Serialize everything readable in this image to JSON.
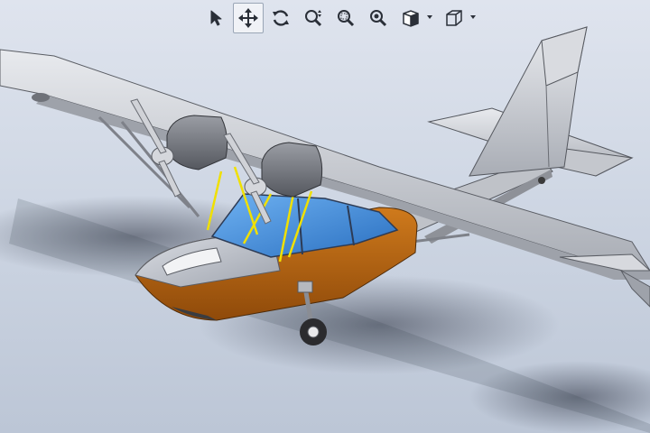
{
  "viewport": {
    "background_top": "#dfe4ee",
    "background_bottom": "#bcc6d6",
    "model": "amphibious-twin-engine-aircraft"
  },
  "colors": {
    "hull": "#b8610f",
    "canopy": "#3f8ee0",
    "struts": "#f0e000",
    "body_gray": "#c9ccd2"
  },
  "toolbar": {
    "tools": [
      {
        "name": "select",
        "icon": "arrow-pointer-icon",
        "active": false
      },
      {
        "name": "pan",
        "icon": "move-arrows-icon",
        "active": true
      },
      {
        "name": "rotate",
        "icon": "rotate-view-icon",
        "active": false
      },
      {
        "name": "zoom-in-out",
        "icon": "zoom-in-out-icon",
        "active": false
      },
      {
        "name": "zoom-to-area",
        "icon": "zoom-to-area-icon",
        "active": false
      },
      {
        "name": "zoom-to-fit",
        "icon": "zoom-to-fit-icon",
        "active": false
      },
      {
        "name": "view-orientation",
        "icon": "view-orientation-icon",
        "active": false,
        "dropdown": true
      },
      {
        "name": "display-style",
        "icon": "display-style-cube-icon",
        "active": false,
        "dropdown": true
      }
    ]
  }
}
